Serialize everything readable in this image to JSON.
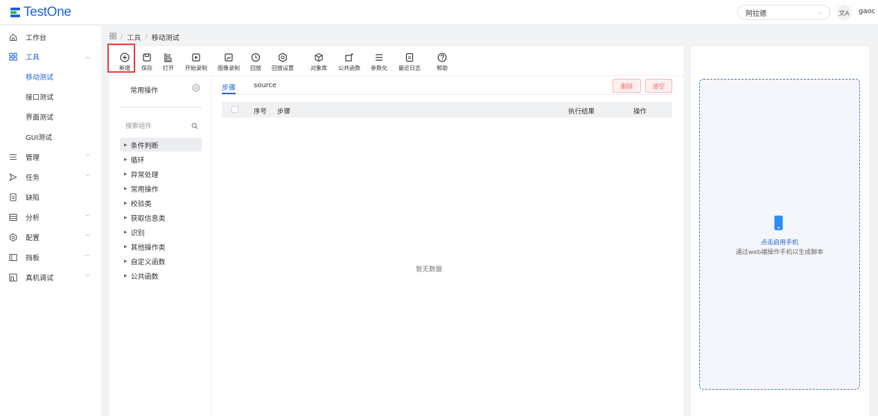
{
  "app": {
    "name": "TestOne"
  },
  "header": {
    "project": "阿拉德",
    "lang_icon": "translate-icon",
    "user": "gaoc"
  },
  "sidebar": {
    "items": [
      {
        "label": "工作台",
        "icon": "home-icon"
      },
      {
        "label": "工具",
        "icon": "grid-icon",
        "expanded": true
      },
      {
        "label": "管理",
        "icon": "list-icon"
      },
      {
        "label": "任务",
        "icon": "send-icon"
      },
      {
        "label": "缺陷",
        "icon": "doc-icon"
      },
      {
        "label": "分析",
        "icon": "window-icon"
      },
      {
        "label": "配置",
        "icon": "gear-icon"
      },
      {
        "label": "挡板",
        "icon": "panel-icon"
      },
      {
        "label": "真机调试",
        "icon": "device-icon"
      }
    ],
    "sub_items": [
      {
        "label": "移动测试",
        "active": true
      },
      {
        "label": "接口测试"
      },
      {
        "label": "界面测试"
      },
      {
        "label": "GUI测试"
      }
    ]
  },
  "breadcrumb": {
    "sep": "/",
    "items": [
      "工具",
      "移动测试"
    ]
  },
  "toolbar": [
    {
      "label": "新增",
      "icon": "plus-circle-icon"
    },
    {
      "label": "保存",
      "icon": "save-icon"
    },
    {
      "label": "打开",
      "icon": "open-icon"
    },
    {
      "label": "开始录制",
      "icon": "play-icon"
    },
    {
      "label": "图像录制",
      "icon": "image-icon"
    },
    {
      "label": "回放",
      "icon": "replay-icon"
    },
    {
      "label": "回放设置",
      "icon": "gear-icon"
    },
    {
      "label": "对象库",
      "icon": "cube-icon"
    },
    {
      "label": "公共函数",
      "icon": "function-icon"
    },
    {
      "label": "参数化",
      "icon": "list-icon"
    },
    {
      "label": "最近日志",
      "icon": "log-icon"
    },
    {
      "label": "帮助",
      "icon": "help-icon"
    }
  ],
  "left_panel": {
    "title": "常用操作",
    "search_placeholder": "搜索组件",
    "tree": [
      "条件判断",
      "循环",
      "异常处理",
      "常用操作",
      "校验类",
      "获取信息类",
      "识别",
      "其他操作类",
      "自定义函数",
      "公共函数"
    ]
  },
  "tabs": [
    {
      "label": "步骤",
      "active": true
    },
    {
      "label": "source"
    }
  ],
  "actions": {
    "delete": "删除",
    "clear": "清空"
  },
  "table": {
    "columns": {
      "index": "序号",
      "step": "步骤",
      "result": "执行结果",
      "ops": "操作"
    },
    "empty_text": "暂无数据"
  },
  "phone_panel": {
    "title": "点击启用手机",
    "desc": "通过web端操作手机以生成脚本"
  },
  "colors": {
    "primary": "#1f62d6",
    "danger": "#f56c6c",
    "highlight": "#e53935"
  }
}
